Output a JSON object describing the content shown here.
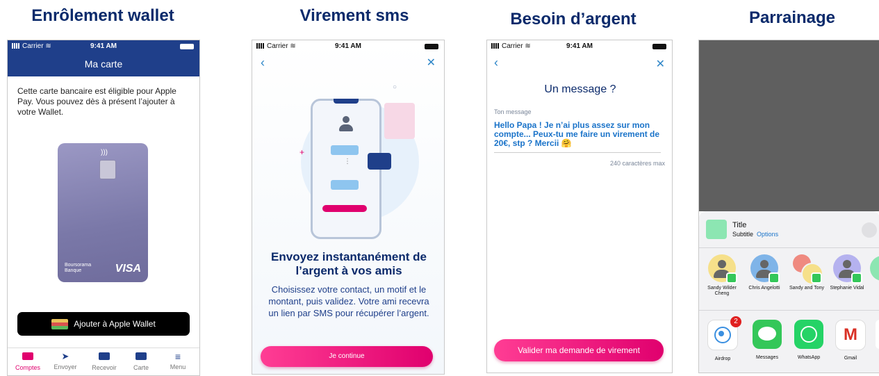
{
  "titles": [
    "Enrôlement wallet",
    "Virement sms",
    "Besoin d’argent",
    "Parrainage"
  ],
  "status": {
    "carrier": "Carrier",
    "time": "9:41 AM"
  },
  "wallet": {
    "header": "Ma carte",
    "intro": "Cette carte bancaire est éligible pour Apple Pay. Vous pouvez dès à présent l’ajouter à votre Wallet.",
    "card_brand": "Boursorama",
    "card_brand_sub": "Banque",
    "card_network": "VISA",
    "add_button": "Ajouter à Apple Wallet",
    "tabs": [
      "Comptes",
      "Envoyer",
      "Recevoir",
      "Carte",
      "Menu"
    ],
    "active_tab": "Comptes"
  },
  "sms": {
    "headline": "Envoyez instantanément de l’argent à vos amis",
    "body": "Choisissez votre contact, un motif et le montant, puis validez. Votre ami recevra un lien par SMS pour récupérer l’argent.",
    "cta": "Je continue"
  },
  "need": {
    "title": "Un message ?",
    "field_label": "Ton message",
    "message": "Hello Papa ! Je n’ai plus assez sur mon compte... Peux-tu me faire un virement de 20€, stp ? Mercii 🤗",
    "counter": "240 caractères max",
    "cta": "Valider ma demande de virement"
  },
  "share": {
    "title": "Title",
    "subtitle": "Subtitle",
    "options": "Options",
    "contacts": [
      "Sandy Wilder Cheng",
      "Chris Angelotti",
      "Sandy and Tony",
      "Stephanie Vidal"
    ],
    "apps": [
      "Airdrop",
      "Messages",
      "WhatsApp",
      "Gmail"
    ],
    "airdrop_badge": "2"
  },
  "colors": {
    "navy": "#0b2a6b",
    "blue_header": "#1f3f8a",
    "pink": "#e0006e",
    "link_blue": "#1a73c9"
  }
}
